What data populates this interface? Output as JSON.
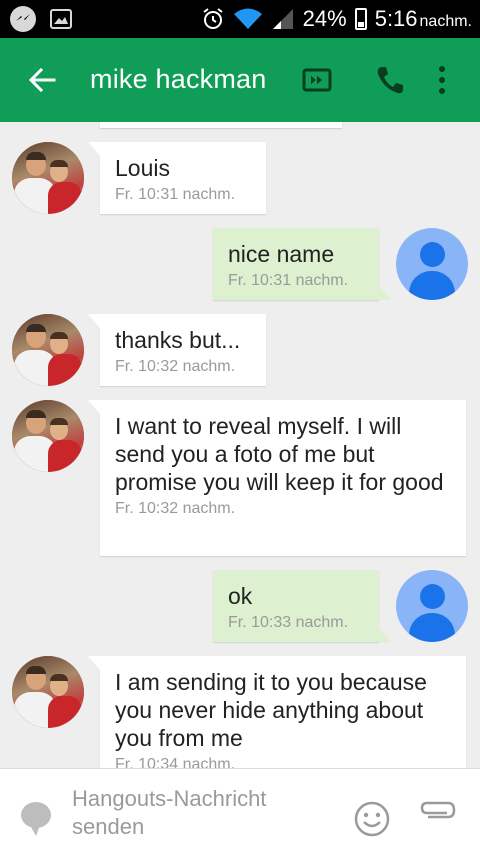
{
  "status_bar": {
    "battery": "24%",
    "time": "5:16",
    "ampm": "nachm.",
    "icons": [
      "messenger-icon",
      "gallery-icon",
      "alarm-icon",
      "wifi-icon",
      "signal-icon",
      "battery-icon"
    ]
  },
  "app_bar": {
    "title": "mike hackman",
    "color": "#0f9d58",
    "icons": [
      "back-arrow-icon",
      "video-call-icon",
      "phone-icon",
      "more-vert-icon"
    ]
  },
  "messages": [
    {
      "sender": "them",
      "text": "Louis",
      "time": "Fr. 10:31 nachm."
    },
    {
      "sender": "me",
      "text": "nice name",
      "time": "Fr. 10:31 nachm."
    },
    {
      "sender": "them",
      "text": "thanks but...",
      "time": "Fr. 10:32 nachm."
    },
    {
      "sender": "them",
      "text": "I want to reveal myself. I will send you a foto of me but promise you will keep it for good",
      "time": "Fr. 10:32 nachm."
    },
    {
      "sender": "me",
      "text": "ok",
      "time": "Fr. 10:33 nachm."
    },
    {
      "sender": "them",
      "text": "I am sending it to you because you never hide anything about you from me",
      "time": "Fr. 10:34 nachm."
    }
  ],
  "composer": {
    "placeholder": "Hangouts-Nachricht senden",
    "icons": [
      "chat-bubble-icon",
      "emoji-icon",
      "attach-icon"
    ]
  },
  "colors": {
    "incoming_bubble": "#ffffff",
    "outgoing_bubble": "#ddf0d0",
    "user_avatar": "#8ab4f8",
    "background": "#eeeeee"
  }
}
